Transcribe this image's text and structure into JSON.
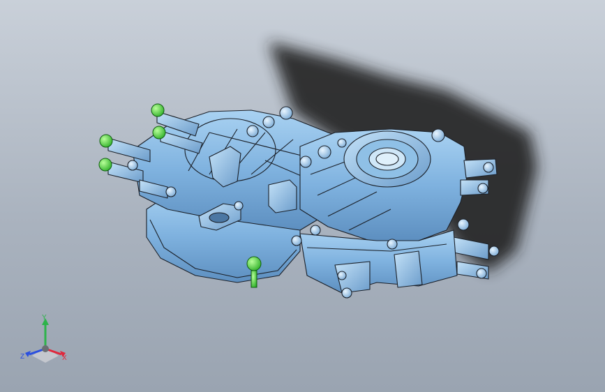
{
  "viewport": {
    "background_top": "#c9d0d9",
    "background_bottom": "#9aa4b1",
    "model_color": "#7fb2df",
    "edge_color": "#1a1f27",
    "fastener_color": "#3fd43f",
    "shadow_color": "#222222"
  },
  "triad": {
    "x_label": "X",
    "y_label": "Y",
    "z_label": "Z",
    "x_color": "#e0283c",
    "y_color": "#2db34a",
    "z_color": "#2a4fe0"
  }
}
